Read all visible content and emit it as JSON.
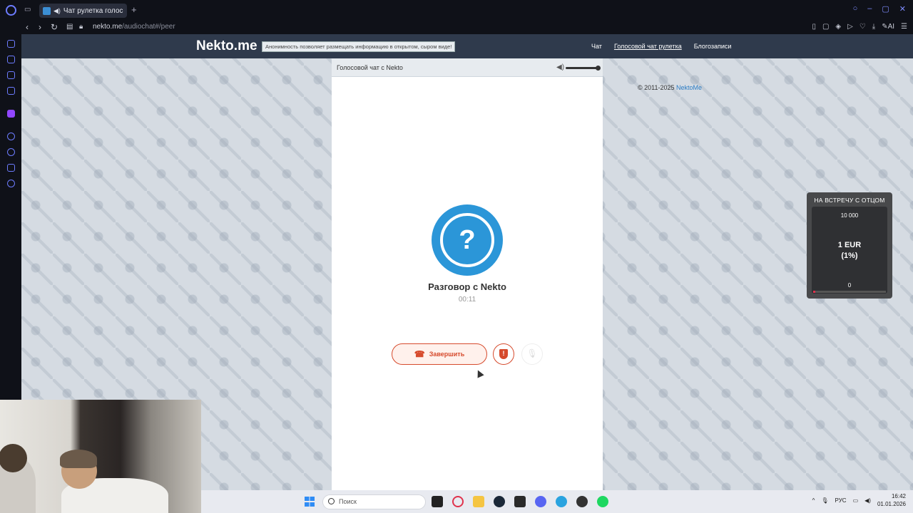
{
  "browser": {
    "tab_title": "Чат рулетка голосова",
    "new_tab": "+",
    "url_host": "nekto.me",
    "url_path": "/audiochat#/peer"
  },
  "site": {
    "logo": "Nekto.me",
    "tagline": "Анонимность позволяет размещать информацию в открытом, сыром виде!",
    "nav": [
      "Чат",
      "Голосовой чат рулетка",
      "Блогозаписи"
    ]
  },
  "panel": {
    "title": "Голосовой чат с Nekto",
    "volume": 1.0
  },
  "call": {
    "avatar_symbol": "?",
    "title": "Разговор с Nekto",
    "timer": "00:11",
    "end_label": "Завершить"
  },
  "footer": {
    "copyright": "© 2011-2025",
    "link": "NektoMe"
  },
  "donation": {
    "title": "НА ВСТРЕЧУ С ОТЦОМ",
    "goal": "10 000",
    "amount": "1 EUR",
    "percent": "(1%)",
    "start": "0",
    "progress": 0.01
  },
  "taskbar": {
    "search_placeholder": "Поиск",
    "language": "РУС",
    "time": "16:42",
    "date": "01.01.2026"
  },
  "colors": {
    "accent_blue": "#2b96d8",
    "end_red": "#d64a2c",
    "header_bg": "#2f3a4c"
  }
}
